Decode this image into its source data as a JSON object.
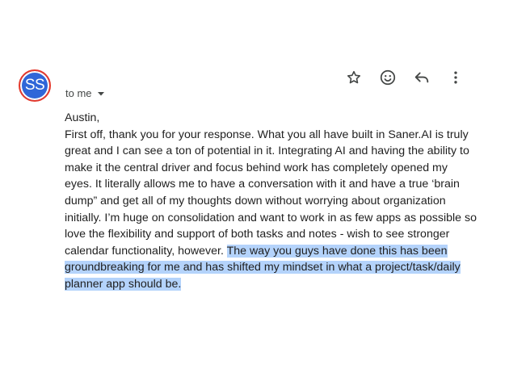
{
  "sender": {
    "initials": "SS",
    "avatar_color": "#2f66d8",
    "avatar_ring_color": "#e4392c"
  },
  "header": {
    "recipient_label": "to me",
    "actions": [
      "star-icon",
      "emoji-reaction-icon",
      "reply-icon",
      "more-options-icon"
    ]
  },
  "message": {
    "greeting": "Austin,",
    "body_plain": "First off, thank you for your response. What you all have built in Saner.AI is truly great and I can see a ton of potential in it. Integrating AI and having the ability to make it the central driver and focus behind work has completely opened my eyes. It literally allows me to have a conversation with it and have a true ‘brain dump” and get all of my thoughts down without worrying about organization initially. I’m huge on consolidation and want to work in as few apps as possible so love the flexibility and support of both tasks and notes - wish to see stronger calendar functionality, however. ",
    "body_highlighted": "The way you guys have done this has been groundbreaking for me and has shifted my mindset in what a project/task/daily planner app should be.",
    "highlight_color": "#b4d3fb"
  }
}
